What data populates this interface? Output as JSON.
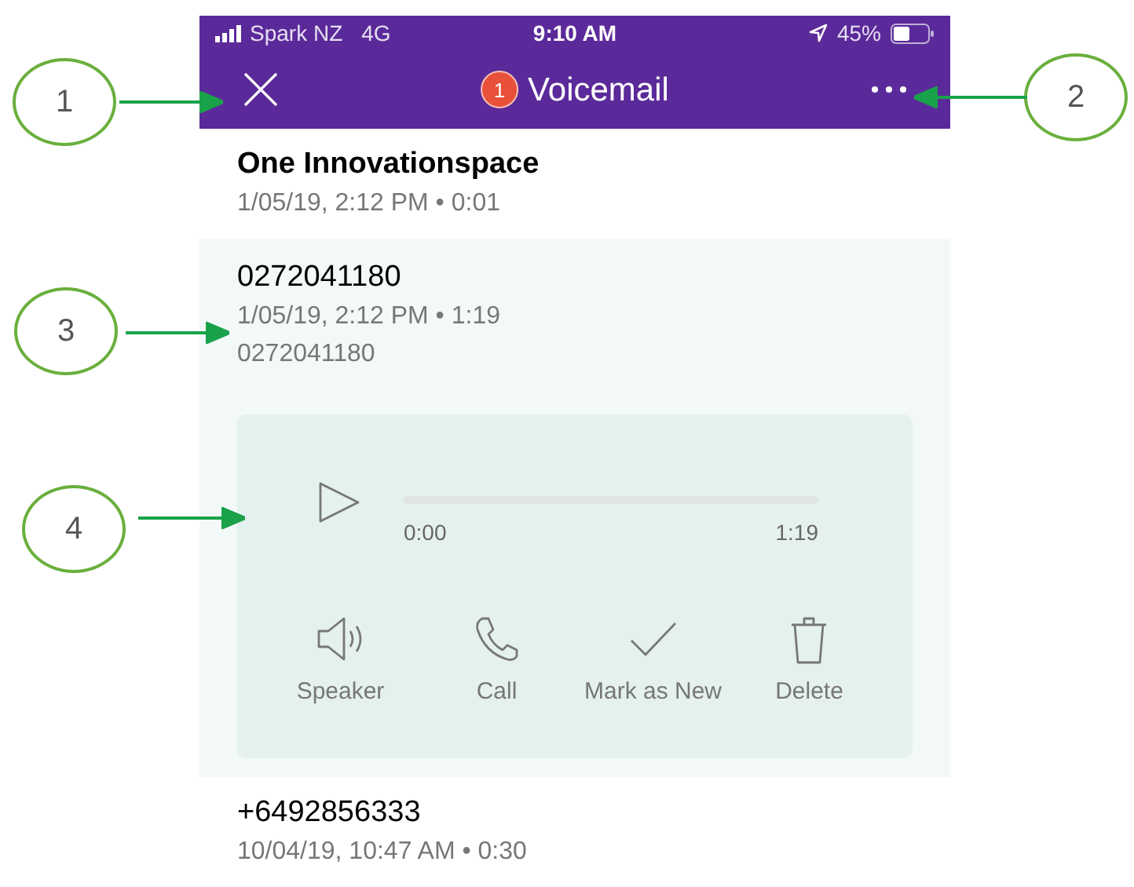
{
  "status_bar": {
    "carrier": "Spark NZ",
    "network": "4G",
    "time": "9:10 AM",
    "battery": "45%"
  },
  "header": {
    "badge": "1",
    "title": "Voicemail"
  },
  "voicemails": [
    {
      "caller": "One Innovationspace",
      "meta": "1/05/19, 2:12 PM • 0:01",
      "unread": true,
      "expanded": false
    },
    {
      "caller": "0272041180",
      "meta": "1/05/19, 2:12 PM • 1:19",
      "number": "0272041180",
      "unread": false,
      "expanded": true,
      "player": {
        "level": 0,
        "start": "0:00",
        "end": "1:19"
      },
      "actions": [
        {
          "kind": "speaker",
          "label": "Speaker"
        },
        {
          "kind": "call",
          "label": "Call"
        },
        {
          "kind": "check",
          "label": "Mark as New"
        },
        {
          "kind": "delete",
          "label": "Delete"
        }
      ]
    },
    {
      "caller": "+6492856333",
      "meta": "10/04/19, 10:47 AM • 0:30",
      "unread": false,
      "expanded": false
    }
  ],
  "callouts": [
    {
      "label": "1"
    },
    {
      "label": "2"
    },
    {
      "label": "3"
    },
    {
      "label": "4"
    }
  ]
}
